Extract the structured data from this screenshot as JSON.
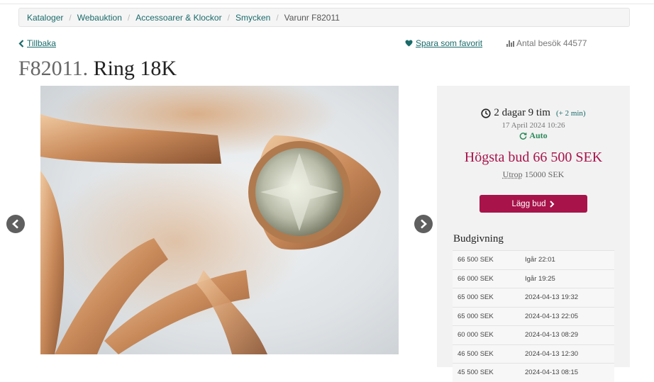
{
  "breadcrumb": {
    "items": [
      "Kataloger",
      "Webauktion",
      "Accessoarer & Klockor",
      "Smycken"
    ],
    "current": "Varunr F82011"
  },
  "actions": {
    "back_label": "Tillbaka",
    "favorite_label": "Spara som favorit",
    "visits_label": "Antal besök 44577"
  },
  "title": {
    "lot": "F82011.",
    "name": "Ring 18K"
  },
  "auction": {
    "time_left": "2 dagar 9 tim",
    "extension": "(+ 2 min)",
    "end_date": "17 April 2024 10:26",
    "auto_label": "Auto",
    "highest_bid": "Högsta bud 66 500 SEK",
    "utrop_label": "Utrop",
    "utrop_value": "15000 SEK",
    "bid_button": "Lägg bud"
  },
  "bidding": {
    "heading": "Budgivning",
    "rows": [
      {
        "amount": "66 500 SEK",
        "time": "Igår 22:01"
      },
      {
        "amount": "66 000 SEK",
        "time": "Igår 19:25"
      },
      {
        "amount": "65 000 SEK",
        "time": "2024-04-13 19:32"
      },
      {
        "amount": "65 000 SEK",
        "time": "2024-04-13 22:05"
      },
      {
        "amount": "60 000 SEK",
        "time": "2024-04-13 08:29"
      },
      {
        "amount": "46 500 SEK",
        "time": "2024-04-13 12:30"
      },
      {
        "amount": "45 500 SEK",
        "time": "2024-04-13 08:15"
      }
    ]
  },
  "colors": {
    "accent": "#a8134a",
    "link": "#1a6a6a",
    "auto": "#2a8a5a"
  },
  "icons": {
    "back": "chevron-left-icon",
    "favorite": "heart-icon",
    "visits": "bar-chart-icon",
    "timer": "clock-icon",
    "auto": "refresh-icon"
  }
}
